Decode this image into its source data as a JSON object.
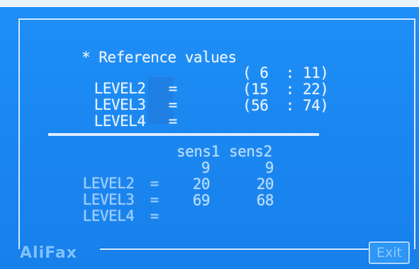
{
  "reference": {
    "title": "* Reference values",
    "rows": [
      {
        "label": "LEVEL2",
        "eq": "=",
        "range": "( 6  : 11)"
      },
      {
        "label": "LEVEL3",
        "eq": "=",
        "range": "(15  : 22)"
      },
      {
        "label": "LEVEL4",
        "eq": "=",
        "range": "(56  : 74)"
      }
    ]
  },
  "measurements": {
    "columns": [
      "sens1",
      "sens2"
    ],
    "rows": [
      {
        "label": "LEVEL2",
        "eq": "=",
        "sens1": "9",
        "sens2": "9"
      },
      {
        "label": "LEVEL3",
        "eq": "=",
        "sens1": "20",
        "sens2": "20"
      },
      {
        "label": "LEVEL4",
        "eq": "=",
        "sens1": "69",
        "sens2": "68"
      }
    ]
  },
  "brand": "AliFax",
  "buttons": {
    "exit": "Exit"
  },
  "colors": {
    "background": "#1e8df5",
    "text": "#e4f2ff",
    "frame": "#cfe6ff",
    "brand": "#7fc0ff"
  }
}
